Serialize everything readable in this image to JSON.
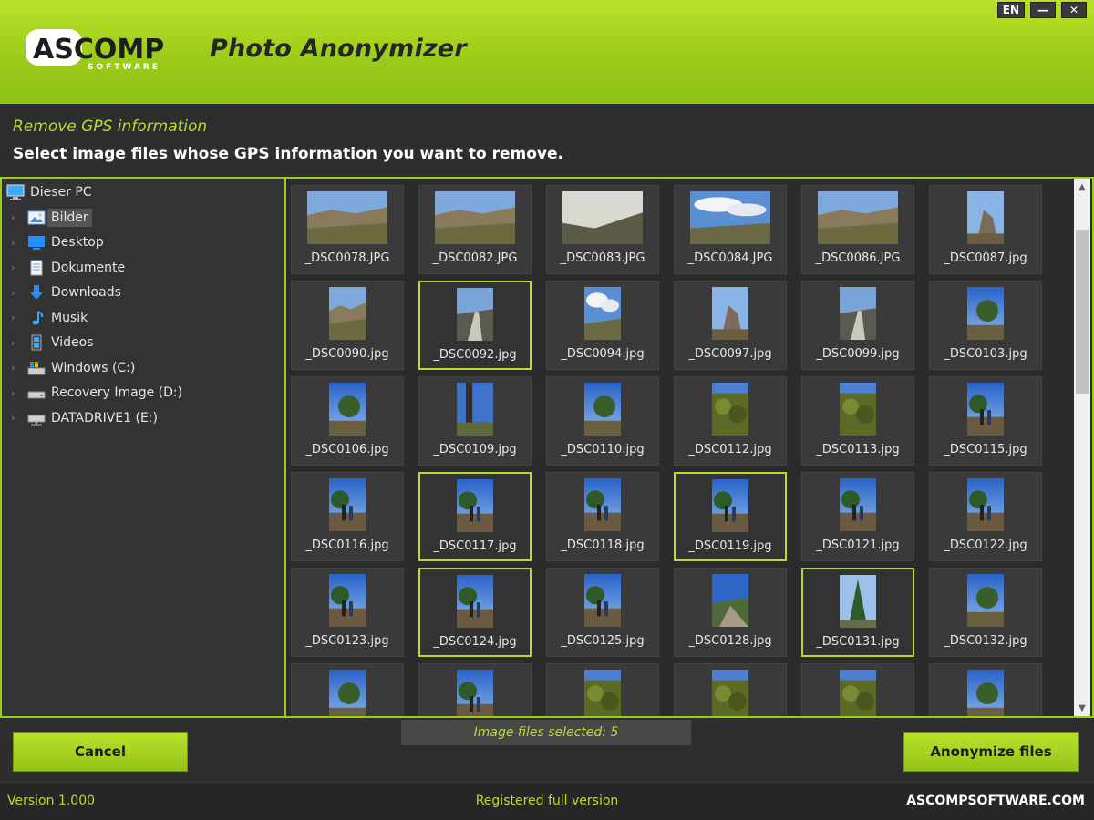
{
  "header": {
    "app_title": "Photo Anonymizer",
    "logo_main": "ASCOMP",
    "logo_sub": "SOFTWARE",
    "lang": "EN",
    "minimize": "—",
    "close": "✕"
  },
  "subband": {
    "title": "Remove GPS information",
    "description": "Select image files whose GPS information you want to remove."
  },
  "tree": [
    {
      "label": "Dieser PC",
      "icon": "computer-icon",
      "level": 0
    },
    {
      "label": "Bilder",
      "icon": "pictures-folder-icon",
      "level": 1,
      "selected": true
    },
    {
      "label": "Desktop",
      "icon": "desktop-folder-icon",
      "level": 1
    },
    {
      "label": "Dokumente",
      "icon": "documents-folder-icon",
      "level": 1
    },
    {
      "label": "Downloads",
      "icon": "download-arrow-icon",
      "level": 1
    },
    {
      "label": "Musik",
      "icon": "music-note-icon",
      "level": 1
    },
    {
      "label": "Videos",
      "icon": "videos-folder-icon",
      "level": 1
    },
    {
      "label": "Windows  (C:)",
      "icon": "system-drive-icon",
      "level": 1
    },
    {
      "label": "Recovery Image (D:)",
      "icon": "drive-icon",
      "level": 1
    },
    {
      "label": "DATADRIVE1 (E:)",
      "icon": "network-drive-icon",
      "level": 1
    }
  ],
  "files": [
    {
      "name": "_DSC0078.JPG",
      "orient": "landscape",
      "selected": false,
      "scene": "valley"
    },
    {
      "name": "_DSC0082.JPG",
      "orient": "landscape",
      "selected": false,
      "scene": "valley"
    },
    {
      "name": "_DSC0083.JPG",
      "orient": "landscape",
      "selected": false,
      "scene": "haze"
    },
    {
      "name": "_DSC0084.JPG",
      "orient": "landscape",
      "selected": false,
      "scene": "cloudy"
    },
    {
      "name": "_DSC0086.JPG",
      "orient": "landscape",
      "selected": false,
      "scene": "valley"
    },
    {
      "name": "_DSC0087.jpg",
      "orient": "portrait",
      "selected": false,
      "scene": "rock"
    },
    {
      "name": "_DSC0090.jpg",
      "orient": "portrait",
      "selected": false,
      "scene": "valley"
    },
    {
      "name": "_DSC0092.jpg",
      "orient": "portrait",
      "selected": true,
      "scene": "road"
    },
    {
      "name": "_DSC0094.jpg",
      "orient": "portrait",
      "selected": false,
      "scene": "cloudy"
    },
    {
      "name": "_DSC0097.jpg",
      "orient": "portrait",
      "selected": false,
      "scene": "rock"
    },
    {
      "name": "_DSC0099.jpg",
      "orient": "portrait",
      "selected": false,
      "scene": "road"
    },
    {
      "name": "_DSC0103.jpg",
      "orient": "portrait",
      "selected": false,
      "scene": "tree"
    },
    {
      "name": "_DSC0106.jpg",
      "orient": "portrait",
      "selected": false,
      "scene": "tree"
    },
    {
      "name": "_DSC0109.jpg",
      "orient": "portrait",
      "selected": false,
      "scene": "trunk"
    },
    {
      "name": "_DSC0110.jpg",
      "orient": "portrait",
      "selected": false,
      "scene": "tree"
    },
    {
      "name": "_DSC0112.jpg",
      "orient": "portrait",
      "selected": false,
      "scene": "forest"
    },
    {
      "name": "_DSC0113.jpg",
      "orient": "portrait",
      "selected": false,
      "scene": "forest"
    },
    {
      "name": "_DSC0115.jpg",
      "orient": "portrait",
      "selected": false,
      "scene": "people"
    },
    {
      "name": "_DSC0116.jpg",
      "orient": "portrait",
      "selected": false,
      "scene": "people"
    },
    {
      "name": "_DSC0117.jpg",
      "orient": "portrait",
      "selected": true,
      "scene": "people"
    },
    {
      "name": "_DSC0118.jpg",
      "orient": "portrait",
      "selected": false,
      "scene": "people"
    },
    {
      "name": "_DSC0119.jpg",
      "orient": "portrait",
      "selected": true,
      "scene": "people"
    },
    {
      "name": "_DSC0121.jpg",
      "orient": "portrait",
      "selected": false,
      "scene": "people"
    },
    {
      "name": "_DSC0122.jpg",
      "orient": "portrait",
      "selected": false,
      "scene": "people"
    },
    {
      "name": "_DSC0123.jpg",
      "orient": "portrait",
      "selected": false,
      "scene": "people"
    },
    {
      "name": "_DSC0124.jpg",
      "orient": "portrait",
      "selected": true,
      "scene": "people"
    },
    {
      "name": "_DSC0125.jpg",
      "orient": "portrait",
      "selected": false,
      "scene": "people"
    },
    {
      "name": "_DSC0128.jpg",
      "orient": "portrait",
      "selected": false,
      "scene": "path"
    },
    {
      "name": "_DSC0131.jpg",
      "orient": "portrait",
      "selected": true,
      "scene": "pine"
    },
    {
      "name": "_DSC0132.jpg",
      "orient": "portrait",
      "selected": false,
      "scene": "tree"
    },
    {
      "name": "",
      "orient": "portrait",
      "selected": false,
      "scene": "tree"
    },
    {
      "name": "",
      "orient": "portrait",
      "selected": false,
      "scene": "people"
    },
    {
      "name": "",
      "orient": "portrait",
      "selected": false,
      "scene": "forest"
    },
    {
      "name": "",
      "orient": "portrait",
      "selected": false,
      "scene": "forest"
    },
    {
      "name": "",
      "orient": "portrait",
      "selected": false,
      "scene": "forest"
    },
    {
      "name": "",
      "orient": "portrait",
      "selected": false,
      "scene": "tree"
    }
  ],
  "footer": {
    "cancel_label": "Cancel",
    "anonymize_label": "Anonymize files",
    "selected_count": "Image files selected: 5"
  },
  "status": {
    "version": "Version 1.000",
    "registered": "Registered full version",
    "site": "ASCOMPSOFTWARE.COM"
  },
  "colors": {
    "accent": "#9ccc1a",
    "accent_text": "#b5de2c",
    "panel": "#333333",
    "background": "#2b2b2b"
  }
}
